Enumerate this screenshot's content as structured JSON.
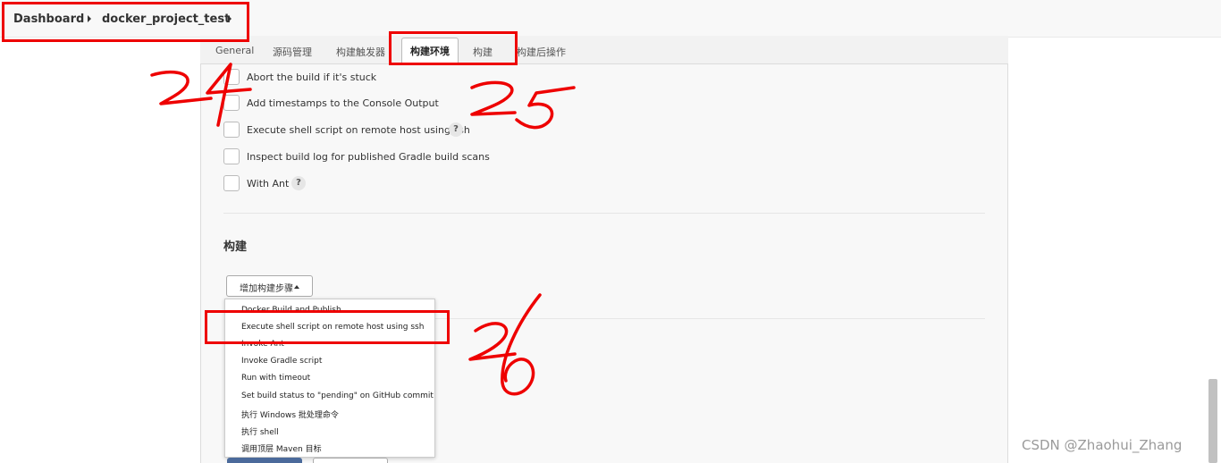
{
  "breadcrumb": {
    "items": [
      "Dashboard",
      "docker_project_test"
    ]
  },
  "tabs": [
    "General",
    "源码管理",
    "构建触发器",
    "构建环境",
    "构建",
    "构建后操作"
  ],
  "active_tab": "构建环境",
  "build_env_options": [
    {
      "label": "Abort the build if it's stuck",
      "checked": false,
      "help": false
    },
    {
      "label": "Add timestamps to the Console Output",
      "checked": false,
      "help": false
    },
    {
      "label": "Execute shell script on remote host using ssh",
      "checked": false,
      "help": true
    },
    {
      "label": "Inspect build log for published Gradle build scans",
      "checked": false,
      "help": false
    },
    {
      "label": "With Ant",
      "checked": false,
      "help": true
    }
  ],
  "help_glyph": "?",
  "build_section": {
    "title": "构建",
    "add_step_label": "增加构建步骤"
  },
  "add_step_menu": [
    "Docker Build and Publish",
    "Execute shell script on remote host using ssh",
    "Invoke Ant",
    "Invoke Gradle script",
    "Run with timeout",
    "Set build status to \"pending\" on GitHub commit",
    "执行 Windows 批处理命令",
    "执行 shell",
    "调用顶层 Maven 目标"
  ],
  "annotations": {
    "labels": [
      "24",
      "25",
      "26"
    ],
    "color": "#ee0000"
  },
  "watermark": "CSDN @Zhaohui_Zhang",
  "colors": {
    "primary_button": "#4b6a9b",
    "panel_bg": "#f8f8f8"
  }
}
